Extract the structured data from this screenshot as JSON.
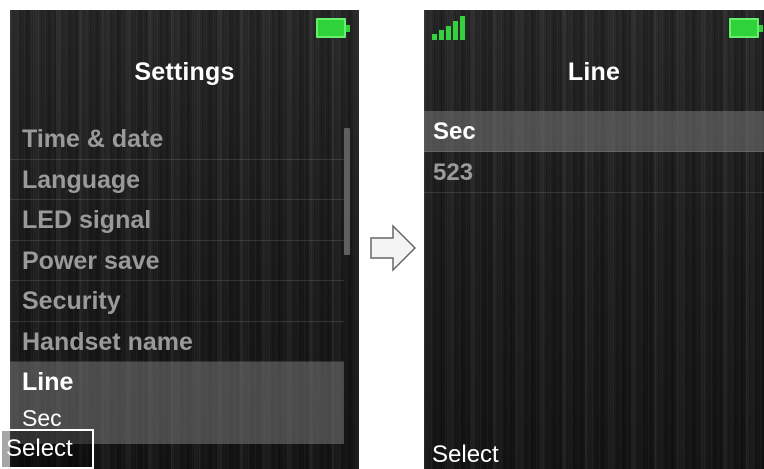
{
  "left_screen": {
    "title": "Settings",
    "menu_items": [
      {
        "label": "Time & date"
      },
      {
        "label": "Language"
      },
      {
        "label": "LED signal"
      },
      {
        "label": "Power save"
      },
      {
        "label": "Security"
      },
      {
        "label": "Handset name"
      }
    ],
    "selected_item": {
      "label": "Line",
      "value": "Sec"
    },
    "softkey": "Select",
    "battery_icon": "battery-full-icon",
    "battery_color": "#2fd23a"
  },
  "transition_icon": "arrow-right-icon",
  "right_screen": {
    "title": "Line",
    "options": [
      {
        "label": "Sec",
        "selected": true
      },
      {
        "label": "523",
        "selected": false
      }
    ],
    "softkey": "Select",
    "signal_icon": "signal-strength-icon",
    "battery_icon": "battery-full-icon",
    "signal_color": "#35d13e"
  }
}
